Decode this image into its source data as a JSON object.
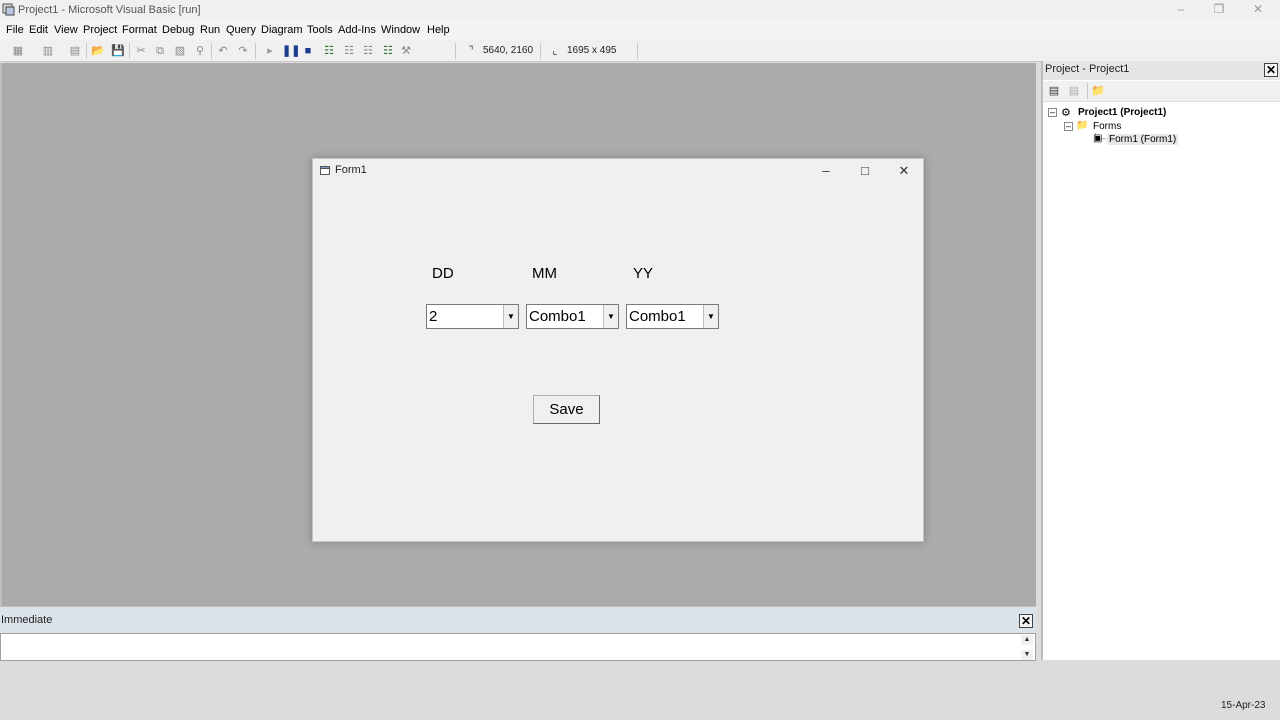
{
  "app": {
    "title": "Project1 - Microsoft Visual Basic [run]",
    "window_controls": {
      "minimize": "–",
      "restore": "❐",
      "close": "✕"
    }
  },
  "menu": [
    "File",
    "Edit",
    "View",
    "Project",
    "Format",
    "Debug",
    "Run",
    "Query",
    "Diagram",
    "Tools",
    "Add-Ins",
    "Window",
    "Help"
  ],
  "toolbar": {
    "position": "5640, 2160",
    "size": "1695 x 495"
  },
  "form": {
    "title": "Form1",
    "controls": {
      "minimize": "–",
      "maximize": "□",
      "close": "✕"
    },
    "labels": {
      "dd": "DD",
      "mm": "MM",
      "yy": "YY"
    },
    "combos": [
      {
        "name": "dd",
        "value": "2"
      },
      {
        "name": "mm",
        "value": "Combo1"
      },
      {
        "name": "yy",
        "value": "Combo1"
      }
    ],
    "save_label": "Save"
  },
  "project_explorer": {
    "title": "Project - Project1",
    "close": "✕",
    "tree": {
      "project": "Project1 (Project1)",
      "folder": "Forms",
      "form_item": "Form1 (Form1)"
    }
  },
  "immediate": {
    "title": "Immediate",
    "close": "✕"
  },
  "status_date": "15-Apr-23"
}
